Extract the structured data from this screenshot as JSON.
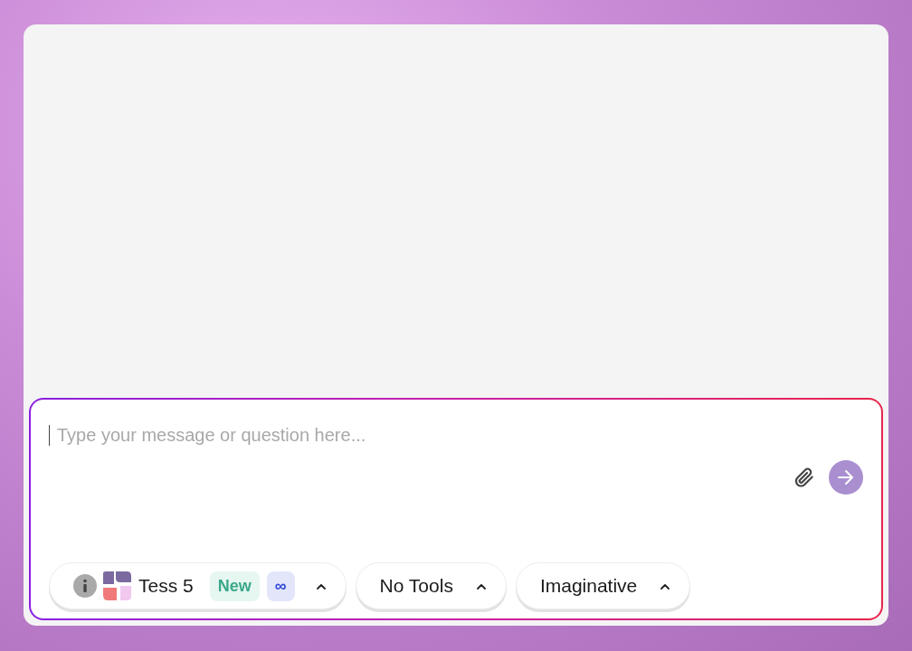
{
  "composer": {
    "placeholder": "Type your message or question here...",
    "model": {
      "name": "Tess 5",
      "badges": [
        {
          "label": "New",
          "kind": "new"
        },
        {
          "label": "∞",
          "kind": "infinite"
        }
      ]
    },
    "selectors": [
      {
        "label": "No Tools"
      },
      {
        "label": "Imaginative"
      }
    ]
  }
}
